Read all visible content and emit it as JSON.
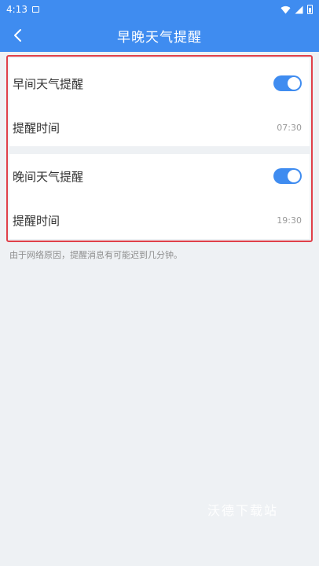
{
  "status_bar": {
    "time": "4:13",
    "icons": [
      "sim-card-icon",
      "wifi-icon",
      "signal-icon",
      "battery-icon"
    ]
  },
  "header": {
    "back_icon": "chevron-left-icon",
    "title": "早晚天气提醒"
  },
  "morning": {
    "label": "早间天气提醒",
    "enabled": true,
    "time_label": "提醒时间",
    "time_value": "07:30"
  },
  "evening": {
    "label": "晚间天气提醒",
    "enabled": true,
    "time_label": "提醒时间",
    "time_value": "19:30"
  },
  "note": "由于网络原因，提醒消息有可能迟到几分钟。",
  "watermark": "沃德下载站",
  "colors": {
    "accent": "#3f8cf0",
    "highlight_border": "#e0404a",
    "background": "#eef1f4"
  }
}
